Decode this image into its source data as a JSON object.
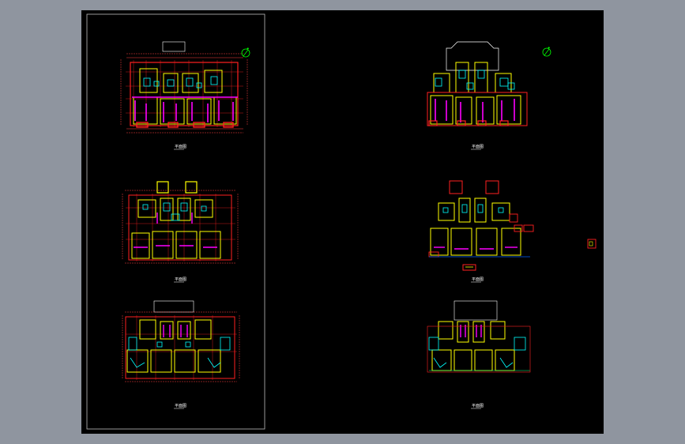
{
  "colors": {
    "app_background": "#8f959f",
    "model_space": "#000000",
    "sheet_border": "#bfbfbf",
    "wall": "#ff2020",
    "partition": "#ffff00",
    "fixture": "#00ffff",
    "window": "#ff00ff",
    "dimension": "#ff4040",
    "outline": "#ffffff",
    "north": "#00ff00"
  },
  "viewport": {
    "name": "model-space",
    "sheet_frame": "left-sheet"
  },
  "drawings": [
    {
      "id": "plan-1",
      "caption": "平面图",
      "column": "left",
      "row": 1,
      "north_arrow": true,
      "north_icon": "north-arrow-icon"
    },
    {
      "id": "plan-2",
      "caption": "平面图",
      "column": "left",
      "row": 2,
      "north_arrow": false
    },
    {
      "id": "plan-3",
      "caption": "平面图",
      "column": "left",
      "row": 3,
      "north_arrow": false
    },
    {
      "id": "plan-4",
      "caption": "平面图",
      "column": "right",
      "row": 1,
      "north_arrow": true,
      "north_icon": "north-arrow-icon"
    },
    {
      "id": "plan-5",
      "caption": "平面图",
      "column": "right",
      "row": 2,
      "north_arrow": false
    },
    {
      "id": "plan-6",
      "caption": "平面图",
      "column": "right",
      "row": 3,
      "north_arrow": false
    }
  ],
  "stray_block": {
    "icon": "detail-block-icon"
  }
}
